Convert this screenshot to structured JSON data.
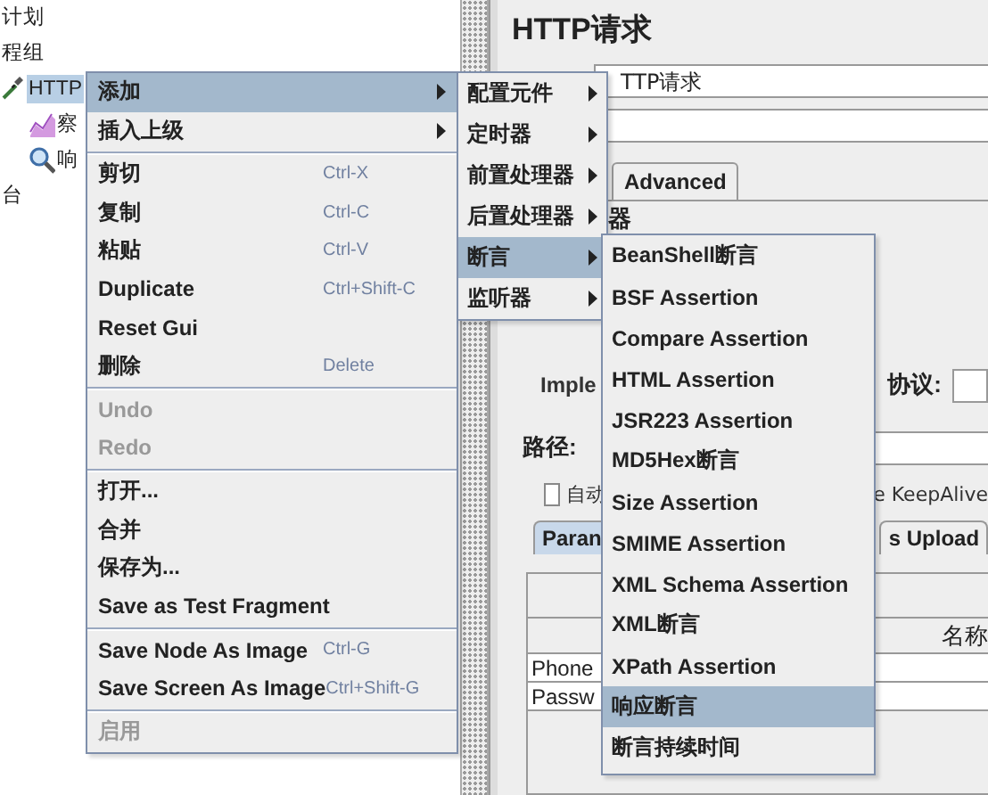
{
  "tree": {
    "items": [
      {
        "label": "计划",
        "selected": false,
        "children": [
          {
            "label": "程组",
            "selected": false,
            "children": [
              {
                "label": "HTTP",
                "selected": true,
                "children": [
                  {
                    "label": "察",
                    "selected": false
                  },
                  {
                    "label": "响",
                    "selected": false
                  }
                ]
              }
            ]
          }
        ]
      },
      {
        "label": "台",
        "selected": false
      }
    ]
  },
  "editor": {
    "title": "HTTP请求",
    "name_field": {
      "value": "TTP请求"
    },
    "tabs": [
      {
        "label": "Advanced",
        "selected": false
      }
    ],
    "server_group_label": "器",
    "implementation_label": "Imple",
    "protocol_label": "协议:",
    "path_label": "路径:",
    "redirect_checkbox": {
      "label": "自动",
      "checked": false
    },
    "keepalive_label": "e KeepAlive",
    "param_tabs": [
      {
        "label": "Paran",
        "selected": true
      },
      {
        "label": "s Upload",
        "selected": false
      }
    ],
    "table": {
      "columns": [
        "名称"
      ],
      "rows": [
        [
          "Phone"
        ],
        [
          "Passw"
        ]
      ]
    }
  },
  "context_menu": {
    "items": [
      {
        "kind": "item",
        "label": "添加",
        "submenu": true,
        "selected": true,
        "disabled": false
      },
      {
        "kind": "item",
        "label": "插入上级",
        "submenu": true,
        "selected": false,
        "disabled": false
      },
      {
        "kind": "separator"
      },
      {
        "kind": "item",
        "label": "剪切",
        "shortcut": "Ctrl-X",
        "submenu": false,
        "selected": false,
        "disabled": false
      },
      {
        "kind": "item",
        "label": "复制",
        "shortcut": "Ctrl-C",
        "submenu": false,
        "selected": false,
        "disabled": false
      },
      {
        "kind": "item",
        "label": "粘贴",
        "shortcut": "Ctrl-V",
        "submenu": false,
        "selected": false,
        "disabled": false
      },
      {
        "kind": "item",
        "label": "Duplicate",
        "shortcut": "Ctrl+Shift-C",
        "submenu": false,
        "selected": false,
        "disabled": false
      },
      {
        "kind": "item",
        "label": "Reset Gui",
        "submenu": false,
        "selected": false,
        "disabled": false
      },
      {
        "kind": "item",
        "label": "删除",
        "shortcut": "Delete",
        "submenu": false,
        "selected": false,
        "disabled": false
      },
      {
        "kind": "separator"
      },
      {
        "kind": "item",
        "label": "Undo",
        "submenu": false,
        "selected": false,
        "disabled": true
      },
      {
        "kind": "item",
        "label": "Redo",
        "submenu": false,
        "selected": false,
        "disabled": true
      },
      {
        "kind": "separator"
      },
      {
        "kind": "item",
        "label": "打开...",
        "submenu": false,
        "selected": false,
        "disabled": false
      },
      {
        "kind": "item",
        "label": "合并",
        "submenu": false,
        "selected": false,
        "disabled": false
      },
      {
        "kind": "item",
        "label": "保存为...",
        "submenu": false,
        "selected": false,
        "disabled": false
      },
      {
        "kind": "item",
        "label": "Save as Test Fragment",
        "submenu": false,
        "selected": false,
        "disabled": false
      },
      {
        "kind": "separator"
      },
      {
        "kind": "item",
        "label": "Save Node As Image",
        "shortcut": "Ctrl-G",
        "submenu": false,
        "selected": false,
        "disabled": false
      },
      {
        "kind": "item",
        "label": "Save Screen As Image",
        "shortcut": "Ctrl+Shift-G",
        "submenu": false,
        "selected": false,
        "disabled": false
      },
      {
        "kind": "separator"
      },
      {
        "kind": "item",
        "label": "启用",
        "submenu": false,
        "selected": false,
        "disabled": true
      }
    ]
  },
  "add_submenu": {
    "items": [
      {
        "label": "配置元件",
        "submenu": true,
        "selected": false
      },
      {
        "label": "定时器",
        "submenu": true,
        "selected": false
      },
      {
        "label": "前置处理器",
        "submenu": true,
        "selected": false
      },
      {
        "label": "后置处理器",
        "submenu": true,
        "selected": false
      },
      {
        "label": "断言",
        "submenu": true,
        "selected": true
      },
      {
        "label": "监听器",
        "submenu": true,
        "selected": false
      }
    ]
  },
  "assertion_submenu": {
    "items": [
      {
        "label": "BeanShell断言",
        "selected": false
      },
      {
        "label": "BSF Assertion",
        "selected": false
      },
      {
        "label": "Compare Assertion",
        "selected": false
      },
      {
        "label": "HTML Assertion",
        "selected": false
      },
      {
        "label": "JSR223 Assertion",
        "selected": false
      },
      {
        "label": "MD5Hex断言",
        "selected": false
      },
      {
        "label": "Size Assertion",
        "selected": false
      },
      {
        "label": "SMIME Assertion",
        "selected": false
      },
      {
        "label": "XML Schema Assertion",
        "selected": false
      },
      {
        "label": "XML断言",
        "selected": false
      },
      {
        "label": "XPath Assertion",
        "selected": false
      },
      {
        "label": "响应断言",
        "selected": true
      },
      {
        "label": "断言持续时间",
        "selected": false
      }
    ]
  }
}
